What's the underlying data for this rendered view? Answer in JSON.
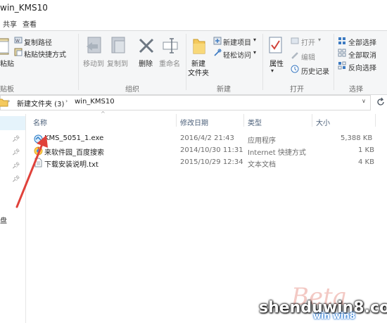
{
  "window": {
    "title": "win_KMS10"
  },
  "ribbon_tabs": [
    "共享",
    "查看"
  ],
  "ribbon": {
    "clipboard": {
      "paste_partial": "粘贴",
      "copy_path": "复制路径",
      "paste_shortcut": "粘贴快捷方式",
      "group_partial": "贴板"
    },
    "organize": {
      "move_to": "移动到",
      "copy_to": "复制到",
      "delete": "删除",
      "rename": "重命名",
      "group": "组织"
    },
    "new": {
      "new_folder_l1": "新建",
      "new_folder_l2": "文件夹",
      "new_item": "新建项目",
      "easy_access": "轻松访问",
      "group": "新建"
    },
    "open": {
      "properties": "属性",
      "open": "打开",
      "edit": "编辑",
      "history": "历史记录",
      "group": "打开"
    },
    "select": {
      "select_all": "全部选择",
      "select_none": "全部取消",
      "invert": "反向选择",
      "group": "选择"
    }
  },
  "address": {
    "crumbs": [
      "新建文件夹 (3)",
      "win_KMS10"
    ]
  },
  "nav_pane": {
    "partial_label": "盘"
  },
  "columns": {
    "name": "名称",
    "modified": "修改日期",
    "type": "类型",
    "size": "大小"
  },
  "files": [
    {
      "name": "KMS_5051_1.exe",
      "modified": "2016/4/2 21:43",
      "type": "应用程序",
      "size": "5,388 KB"
    },
    {
      "name": "来软件园_百度搜索",
      "modified": "2014/10/30 11:31",
      "type": "Internet 快捷方式",
      "size": "1 KB"
    },
    {
      "name": "下载安装说明.txt",
      "modified": "2015/10/29 12:34",
      "type": "文本文档",
      "size": "4 KB"
    }
  ],
  "watermark": {
    "main": "shenduwin8.com",
    "sub": "win win8"
  },
  "colors": {
    "accent": "#1979ca",
    "header_text": "#4c607a",
    "selection": "#e5f3fb",
    "arrow": "#e0413a"
  }
}
